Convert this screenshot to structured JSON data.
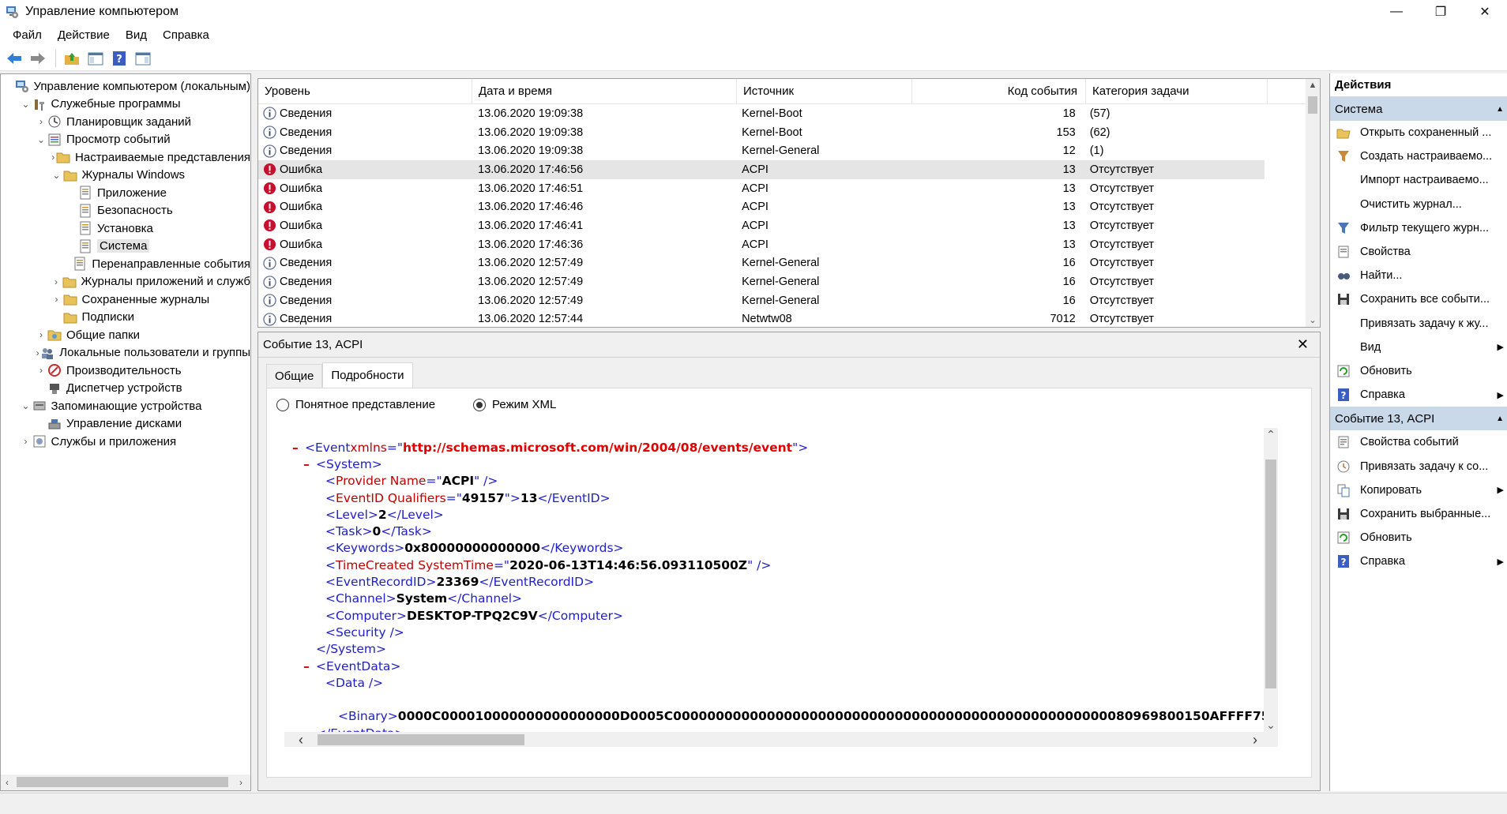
{
  "window": {
    "title": "Управление компьютером",
    "controls": [
      "—",
      "❐",
      "✕"
    ]
  },
  "menu": [
    "Файл",
    "Действие",
    "Вид",
    "Справка"
  ],
  "toolbar": [
    "back-icon",
    "forward-icon",
    "up-folder-icon",
    "show-hide-tree-icon",
    "help-icon",
    "show-hide-action-pane-icon"
  ],
  "tree": [
    {
      "label": "Управление компьютером (локальным)",
      "depth": 0,
      "twisty": "",
      "icon": "computer-management-icon"
    },
    {
      "label": "Служебные программы",
      "depth": 1,
      "twisty": "⌄",
      "icon": "system-tools-icon"
    },
    {
      "label": "Планировщик заданий",
      "depth": 2,
      "twisty": "›",
      "icon": "task-scheduler-icon"
    },
    {
      "label": "Просмотр событий",
      "depth": 2,
      "twisty": "⌄",
      "icon": "event-viewer-icon"
    },
    {
      "label": "Настраиваемые представления",
      "depth": 3,
      "twisty": "›",
      "icon": "folder-icon"
    },
    {
      "label": "Журналы Windows",
      "depth": 3,
      "twisty": "⌄",
      "icon": "folder-icon"
    },
    {
      "label": "Приложение",
      "depth": 4,
      "twisty": "",
      "icon": "log-icon"
    },
    {
      "label": "Безопасность",
      "depth": 4,
      "twisty": "",
      "icon": "log-icon"
    },
    {
      "label": "Установка",
      "depth": 4,
      "twisty": "",
      "icon": "log-icon"
    },
    {
      "label": "Система",
      "depth": 4,
      "twisty": "",
      "icon": "log-icon",
      "selected": true
    },
    {
      "label": "Перенаправленные события",
      "depth": 4,
      "twisty": "",
      "icon": "log-icon"
    },
    {
      "label": "Журналы приложений и служб",
      "depth": 3,
      "twisty": "›",
      "icon": "folder-icon"
    },
    {
      "label": "Сохраненные журналы",
      "depth": 3,
      "twisty": "›",
      "icon": "folder-icon"
    },
    {
      "label": "Подписки",
      "depth": 3,
      "twisty": "",
      "icon": "folder-icon"
    },
    {
      "label": "Общие папки",
      "depth": 2,
      "twisty": "›",
      "icon": "shared-folders-icon"
    },
    {
      "label": "Локальные пользователи и группы",
      "depth": 2,
      "twisty": "›",
      "icon": "users-icon"
    },
    {
      "label": "Производительность",
      "depth": 2,
      "twisty": "›",
      "icon": "performance-icon"
    },
    {
      "label": "Диспетчер устройств",
      "depth": 2,
      "twisty": "",
      "icon": "device-manager-icon"
    },
    {
      "label": "Запоминающие устройства",
      "depth": 1,
      "twisty": "⌄",
      "icon": "storage-icon"
    },
    {
      "label": "Управление дисками",
      "depth": 2,
      "twisty": "",
      "icon": "disk-management-icon"
    },
    {
      "label": "Службы и приложения",
      "depth": 1,
      "twisty": "›",
      "icon": "services-icon"
    }
  ],
  "events": {
    "columns": [
      "Уровень",
      "Дата и время",
      "Источник",
      "Код события",
      "Категория задачи"
    ],
    "rows": [
      {
        "level": "Сведения",
        "type": "info",
        "date": "13.06.2020 19:09:38",
        "source": "Kernel-Boot",
        "code": "18",
        "category": "(57)"
      },
      {
        "level": "Сведения",
        "type": "info",
        "date": "13.06.2020 19:09:38",
        "source": "Kernel-Boot",
        "code": "153",
        "category": "(62)"
      },
      {
        "level": "Сведения",
        "type": "info",
        "date": "13.06.2020 19:09:38",
        "source": "Kernel-General",
        "code": "12",
        "category": "(1)"
      },
      {
        "level": "Ошибка",
        "type": "error",
        "date": "13.06.2020 17:46:56",
        "source": "ACPI",
        "code": "13",
        "category": "Отсутствует",
        "selected": true
      },
      {
        "level": "Ошибка",
        "type": "error",
        "date": "13.06.2020 17:46:51",
        "source": "ACPI",
        "code": "13",
        "category": "Отсутствует"
      },
      {
        "level": "Ошибка",
        "type": "error",
        "date": "13.06.2020 17:46:46",
        "source": "ACPI",
        "code": "13",
        "category": "Отсутствует"
      },
      {
        "level": "Ошибка",
        "type": "error",
        "date": "13.06.2020 17:46:41",
        "source": "ACPI",
        "code": "13",
        "category": "Отсутствует"
      },
      {
        "level": "Ошибка",
        "type": "error",
        "date": "13.06.2020 17:46:36",
        "source": "ACPI",
        "code": "13",
        "category": "Отсутствует"
      },
      {
        "level": "Сведения",
        "type": "info",
        "date": "13.06.2020 12:57:49",
        "source": "Kernel-General",
        "code": "16",
        "category": "Отсутствует"
      },
      {
        "level": "Сведения",
        "type": "info",
        "date": "13.06.2020 12:57:49",
        "source": "Kernel-General",
        "code": "16",
        "category": "Отсутствует"
      },
      {
        "level": "Сведения",
        "type": "info",
        "date": "13.06.2020 12:57:49",
        "source": "Kernel-General",
        "code": "16",
        "category": "Отсутствует"
      },
      {
        "level": "Сведения",
        "type": "info",
        "date": "13.06.2020 12:57:44",
        "source": "Netwtw08",
        "code": "7012",
        "category": "Отсутствует"
      }
    ]
  },
  "details": {
    "title": "Событие 13, ACPI",
    "tabs": [
      "Общие",
      "Подробности"
    ],
    "radio_friendly": "Понятное представление",
    "radio_xml": "Режим XML",
    "xml": {
      "event_ns_attr": "xmlns",
      "event_ns": "http://schemas.microsoft.com/win/2004/08/events/event",
      "provider_name": "ACPI",
      "event_qualifiers": "49157",
      "event_id": "13",
      "level": "2",
      "task": "0",
      "keywords": "0x80000000000000",
      "time_created": "2020-06-13T14:46:56.093110500Z",
      "event_record_id": "23369",
      "channel": "System",
      "computer": "DESKTOP-TPQ2C9V",
      "binary": "0000C000010000000000000000D0005C000000000000000000000000000000000000000000000000000080969800150AFFFF75"
    }
  },
  "actions": {
    "title": "Действия",
    "sections": [
      {
        "label": "Система",
        "items": [
          {
            "label": "Открыть сохраненный ...",
            "icon": "open-folder-icon"
          },
          {
            "label": "Создать настраиваемо...",
            "icon": "filter-create-icon"
          },
          {
            "label": "Импорт настраиваемо...",
            "icon": ""
          },
          {
            "label": "Очистить журнал...",
            "icon": ""
          },
          {
            "label": "Фильтр текущего журн...",
            "icon": "filter-icon"
          },
          {
            "label": "Свойства",
            "icon": "properties-icon"
          },
          {
            "label": "Найти...",
            "icon": "find-icon"
          },
          {
            "label": "Сохранить все событи...",
            "icon": "save-icon"
          },
          {
            "label": "Привязать задачу к жу...",
            "icon": ""
          },
          {
            "label": "Вид",
            "icon": "",
            "submenu": true
          },
          {
            "label": "Обновить",
            "icon": "refresh-icon"
          },
          {
            "label": "Справка",
            "icon": "help-icon",
            "submenu": true
          }
        ]
      },
      {
        "label": "Событие 13, ACPI",
        "items": [
          {
            "label": "Свойства событий",
            "icon": "event-properties-icon"
          },
          {
            "label": "Привязать задачу к со...",
            "icon": "attach-task-icon"
          },
          {
            "label": "Копировать",
            "icon": "copy-icon",
            "submenu": true
          },
          {
            "label": "Сохранить выбранные...",
            "icon": "save-icon"
          },
          {
            "label": "Обновить",
            "icon": "refresh-icon"
          },
          {
            "label": "Справка",
            "icon": "help-icon",
            "submenu": true
          }
        ]
      }
    ]
  }
}
